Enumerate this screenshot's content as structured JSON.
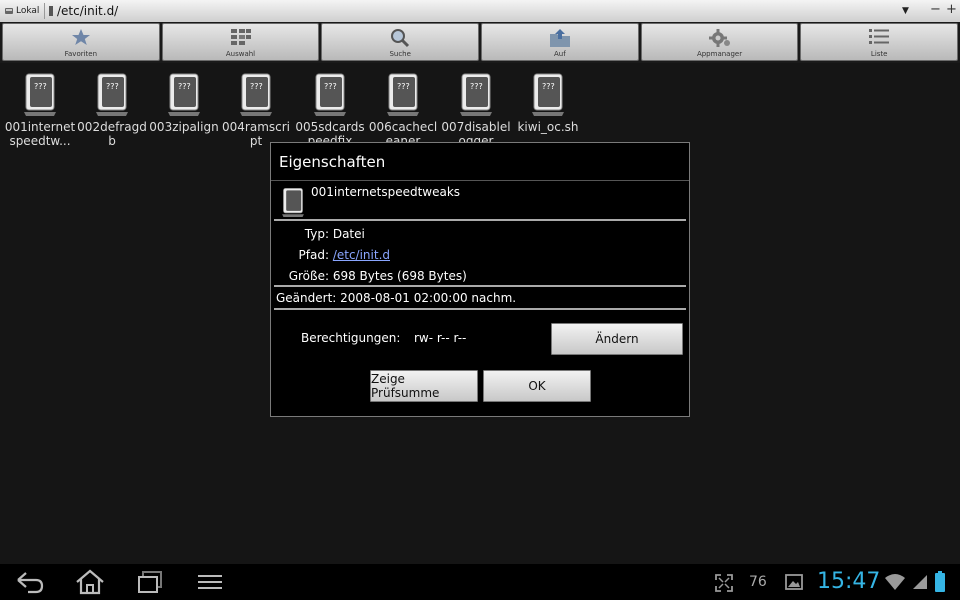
{
  "pathbar": {
    "location_label": "Lokal",
    "path": "/etc/init.d/",
    "dropdown_glyph": "▼",
    "minus_glyph": "−",
    "plus_glyph": "+"
  },
  "toolbar": {
    "buttons": [
      {
        "label": "Favoriten",
        "icon": "star-icon"
      },
      {
        "label": "Auswahl",
        "icon": "select-grid-icon"
      },
      {
        "label": "Suche",
        "icon": "search-icon"
      },
      {
        "label": "Auf",
        "icon": "folder-up-icon"
      },
      {
        "label": "Appmanager",
        "icon": "gear-icon"
      },
      {
        "label": "Liste",
        "icon": "list-icon"
      }
    ]
  },
  "files": [
    {
      "name": "001internetspeedtw..."
    },
    {
      "name": "002defragdb"
    },
    {
      "name": "003zipalign"
    },
    {
      "name": "004ramscript"
    },
    {
      "name": "005sdcardspeedfix"
    },
    {
      "name": "006cachecleaner"
    },
    {
      "name": "007disablelogger"
    },
    {
      "name": "kiwi_oc.sh"
    }
  ],
  "dialog": {
    "title": "Eigenschaften",
    "file_name": "001internetspeedtweaks",
    "type_label": "Typ:",
    "type_value": "Datei",
    "path_label": "Pfad:",
    "path_value": "/etc/init.d",
    "size_label": "Größe:",
    "size_value": "698 Bytes (698 Bytes)",
    "modified_label": "Geändert:",
    "modified_value": "2008-08-01 02:00:00 nachm.",
    "permissions_label": "Berechtigungen:",
    "permissions_value": "rw- r-- r--",
    "change_button": "Ändern",
    "checksum_button": "Zeige Prüfsumme",
    "ok_button": "OK"
  },
  "navbar": {
    "battery_percent_label": "76",
    "clock": "15:47",
    "accent_color": "#35b5e5"
  }
}
